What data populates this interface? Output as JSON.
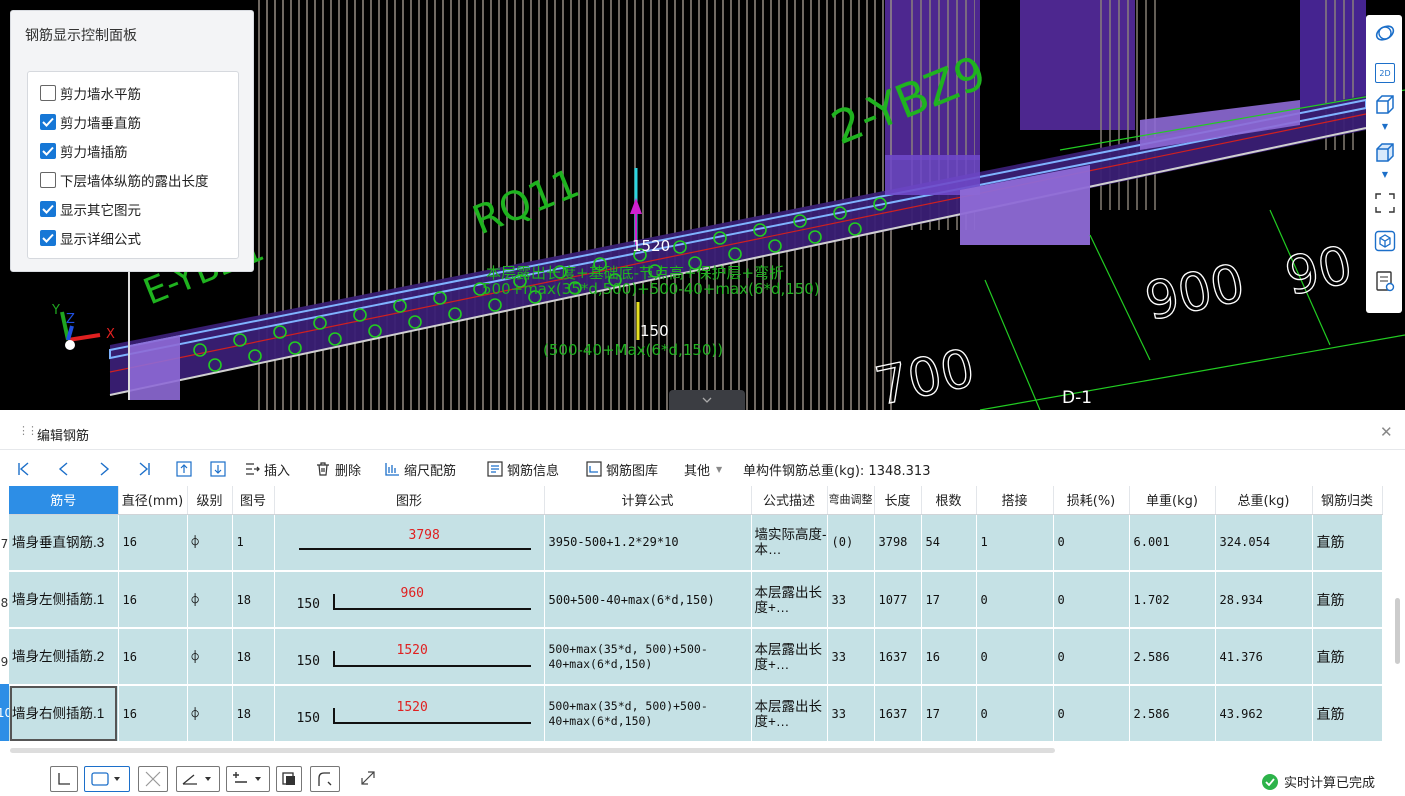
{
  "control_panel": {
    "title": "钢筋显示控制面板",
    "options": [
      {
        "label": "剪力墙水平筋",
        "checked": false
      },
      {
        "label": "剪力墙垂直筋",
        "checked": true
      },
      {
        "label": "剪力墙插筋",
        "checked": true
      },
      {
        "label": "下层墙体纵筋的露出长度",
        "checked": false
      },
      {
        "label": "显示其它图元",
        "checked": true
      },
      {
        "label": "显示详细公式",
        "checked": true
      }
    ]
  },
  "viewport": {
    "labels": {
      "wall_name": "RQ11",
      "column_name": "2-YBZ9",
      "left_partial": "E-YBZ1",
      "dim_top": "1520",
      "dim_mid": "150",
      "formula_green_1": "本层露出长度+基础底-节点高+保护层+弯折",
      "formula_green_2": "500+max(35*d,500)+500-40+max(6*d,150)",
      "formula_green_3": "(500-40+Max(6*d,150))",
      "dim_700": "700",
      "dim_900": "900",
      "dim_90": "90",
      "axis": "D-1",
      "view_2d": "2D"
    }
  },
  "editor": {
    "title": "编辑钢筋",
    "toolbar": {
      "insert": "插入",
      "delete": "删除",
      "scale": "缩尺配筋",
      "info": "钢筋信息",
      "library": "钢筋图库",
      "other": "其他",
      "weight_label": "单构件钢筋总重(kg): 1348.313"
    },
    "columns": [
      "筋号",
      "直径(mm)",
      "级别",
      "图号",
      "图形",
      "计算公式",
      "公式描述",
      "弯曲调整",
      "长度",
      "根数",
      "搭接",
      "损耗(%)",
      "单重(kg)",
      "总重(kg)",
      "钢筋归类"
    ],
    "rows": [
      {
        "num": "7",
        "name": "墙身垂直钢筋.3",
        "dia": "16",
        "grade": "⌽",
        "fig": "1",
        "left": "",
        "shape": "3798",
        "formula": "3950-500+1.2*29*10",
        "desc": "墙实际高度-本…",
        "bend": "(0)",
        "len": "3798",
        "count": "54",
        "lap": "1",
        "loss": "0",
        "unit": "6.001",
        "total": "324.054",
        "type": "直筋"
      },
      {
        "num": "8",
        "name": "墙身左侧插筋.1",
        "dia": "16",
        "grade": "⌽",
        "fig": "18",
        "left": "150",
        "shape": "960",
        "formula": "500+500-40+max(6*d,150)",
        "desc": "本层露出长度+…",
        "bend": "33",
        "len": "1077",
        "count": "17",
        "lap": "0",
        "loss": "0",
        "unit": "1.702",
        "total": "28.934",
        "type": "直筋"
      },
      {
        "num": "9",
        "name": "墙身左侧插筋.2",
        "dia": "16",
        "grade": "⌽",
        "fig": "18",
        "left": "150",
        "shape": "1520",
        "formula": "500+max(35*d, 500)+500-40+max(6*d,150)",
        "desc": "本层露出长度+…",
        "bend": "33",
        "len": "1637",
        "count": "16",
        "lap": "0",
        "loss": "0",
        "unit": "2.586",
        "total": "41.376",
        "type": "直筋"
      },
      {
        "num": "10",
        "name": "墙身右侧插筋.1",
        "dia": "16",
        "grade": "⌽",
        "fig": "18",
        "left": "150",
        "shape": "1520",
        "formula": "500+max(35*d, 500)+500-40+max(6*d,150)",
        "desc": "本层露出长度+…",
        "bend": "33",
        "len": "1637",
        "count": "17",
        "lap": "0",
        "loss": "0",
        "unit": "2.586",
        "total": "43.962",
        "type": "直筋"
      }
    ]
  },
  "status": {
    "text": "实时计算已完成"
  }
}
